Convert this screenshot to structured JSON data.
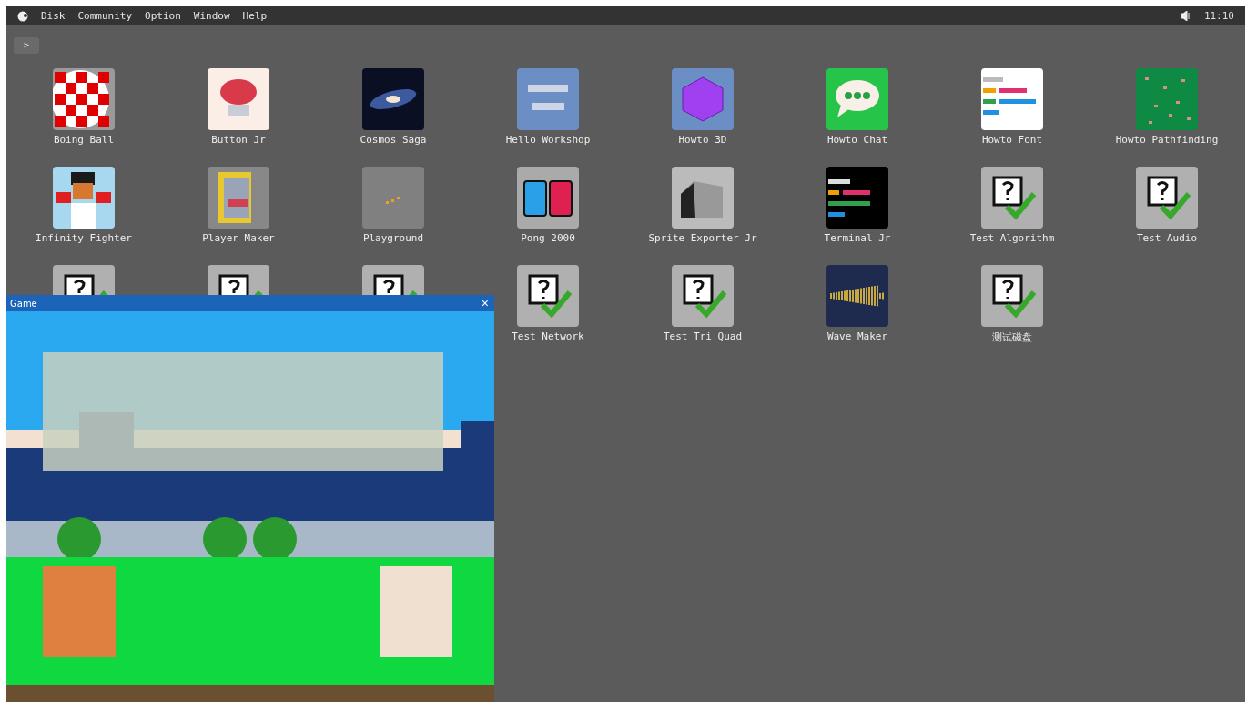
{
  "menu_bar": {
    "items": [
      "Disk",
      "Community",
      "Option",
      "Window",
      "Help"
    ],
    "clock": "11:10"
  },
  "toolbar": {
    "button": ">"
  },
  "apps": [
    {
      "kind": "boing",
      "label": "Boing Ball"
    },
    {
      "kind": "button",
      "label": "Button Jr"
    },
    {
      "kind": "cosmos",
      "label": "Cosmos Saga"
    },
    {
      "kind": "workshop",
      "label": "Hello Workshop"
    },
    {
      "kind": "cube",
      "label": "Howto 3D"
    },
    {
      "kind": "chat",
      "label": "Howto Chat"
    },
    {
      "kind": "font",
      "label": "Howto Font"
    },
    {
      "kind": "map",
      "label": "Howto Pathfinding"
    },
    {
      "kind": "fighter",
      "label": "Infinity Fighter"
    },
    {
      "kind": "maker",
      "label": "Player Maker"
    },
    {
      "kind": "playground",
      "label": "Playground"
    },
    {
      "kind": "pong",
      "label": "Pong 2000"
    },
    {
      "kind": "sprite",
      "label": "Sprite Exporter Jr"
    },
    {
      "kind": "terminal",
      "label": "Terminal Jr"
    },
    {
      "kind": "test",
      "label": "Test Algorithm"
    },
    {
      "kind": "test",
      "label": "Test Audio"
    },
    {
      "kind": "test"
    },
    {
      "kind": "test"
    },
    {
      "kind": "test"
    },
    {
      "kind": "test",
      "label": "Test Network"
    },
    {
      "kind": "test",
      "label": "Test Tri Quad"
    },
    {
      "kind": "wave",
      "label": "Wave Maker"
    },
    {
      "kind": "test",
      "label": "测试磁盘"
    }
  ],
  "game_window": {
    "title": "Game",
    "close": "×"
  }
}
